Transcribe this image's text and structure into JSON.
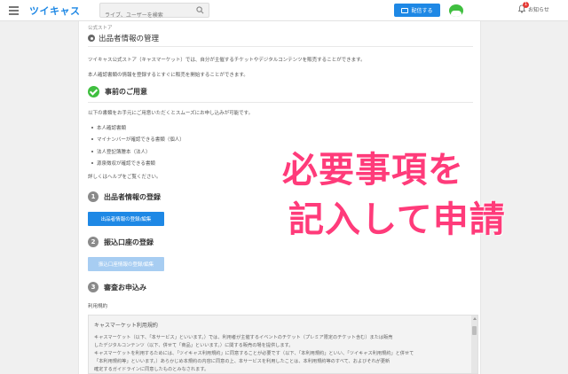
{
  "header": {
    "logo": "ツイキャス",
    "search_placeholder": "ライブ、ユーザーを検索",
    "live_button": "配信する",
    "notifications_label": "お知らせ",
    "notifications_count": "1"
  },
  "breadcrumb": "公式ストア",
  "page": {
    "title": "出品者情報の管理",
    "intro1": "ツイキャス公式ストア（キャスマーケット）では、自分が主催するチケットやデジタルコンテンツを販売することができます。",
    "intro2": "本人確認書類の情報を登録するとすぐに販売を開始することができます。"
  },
  "prep": {
    "title": "事前のご用意",
    "desc": "以下の書類をお手元にご用意いただくとスムーズにお申し込みが可能です。",
    "items": [
      "本人確認書類",
      "マイナンバーが確認できる書類（個人）",
      "法人登記簿謄本（法人）",
      "源泉徴収が確認できる書類"
    ],
    "more": "詳しくはヘルプをご覧ください。"
  },
  "steps": [
    {
      "num": "1",
      "title": "出品者情報の登録",
      "button": "出品者情報の登録/編集"
    },
    {
      "num": "2",
      "title": "振込口座の登録",
      "button": "振込口座情報の登録/編集"
    },
    {
      "num": "3",
      "title": "審査お申込み"
    }
  ],
  "terms": {
    "label": "利用規約",
    "heading": "キャスマーケット利用規約",
    "lines": [
      "キャスマーケット（以下、「本サービス」といいます。）では、利用者が主催するイベントのチケット（プレミア限定のチケット含む）または販売",
      "したデジタルコンテンツ（以下、併せて「商品」といいます。）に関する販売の場を提供します。",
      "キャスマーケットを利用するためには、「ツイキャス利用規約」に同意することが必要です（以下、「本利用規約」といい、「ツイキャス利用規約」と併せて",
      "「本利用規約等」といいます。）あらかじめ本規約の内容に同意の上、本サービスを利用したことは、本利用規約等のすべて、およびそれが更新",
      "確定するガイドラインに同意したものとみなされます。"
    ]
  },
  "overlay": {
    "line1": "必要事項を",
    "line2": "記入して申請"
  },
  "colors": {
    "accent": "#1e88e5",
    "overlay": "#ff3b7a",
    "success": "#3fbf3f"
  }
}
